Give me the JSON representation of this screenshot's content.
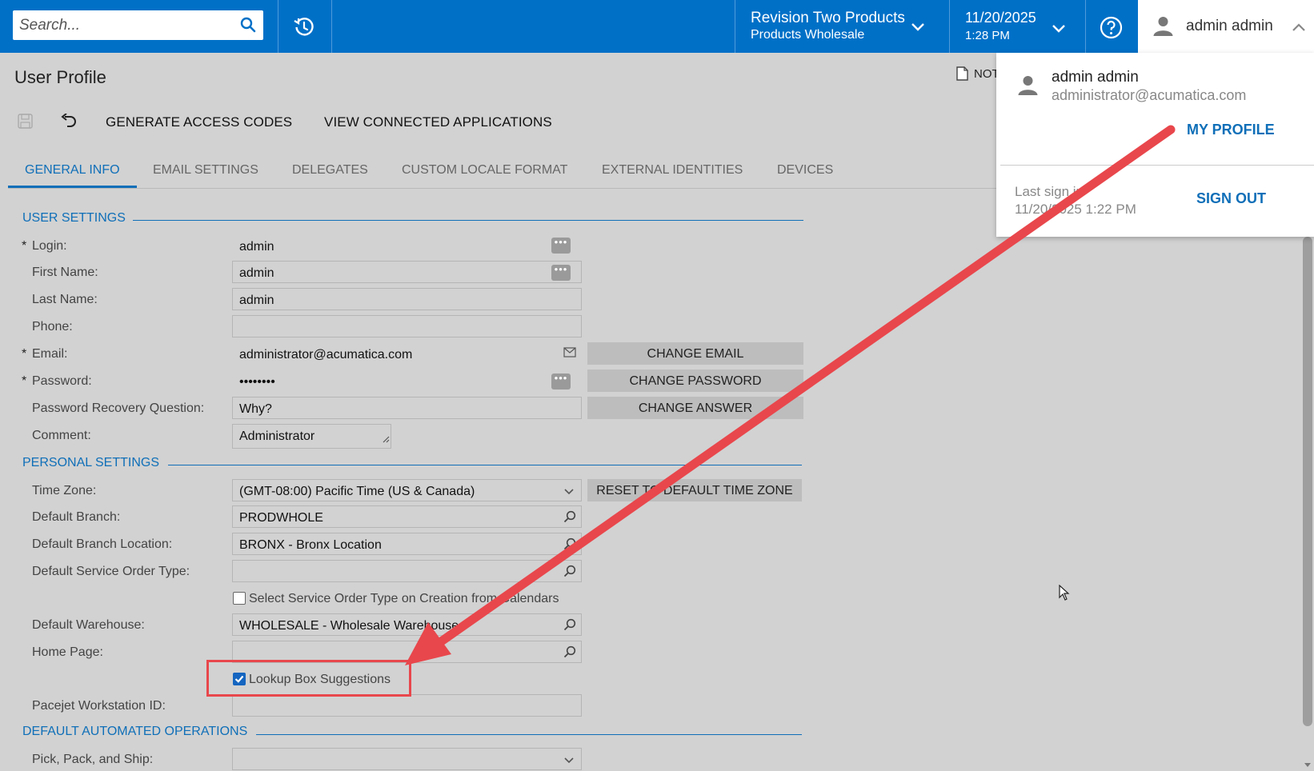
{
  "topbar": {
    "search_placeholder": "Search...",
    "company_name": "Revision Two Products",
    "branch_name": "Products Wholesale",
    "date": "11/20/2025",
    "time": "1:28 PM",
    "user_name": "admin admin"
  },
  "page": {
    "title": "User Profile",
    "notes_label": "NOT",
    "toolbar": {
      "generate_label": "GENERATE ACCESS CODES",
      "view_apps_label": "VIEW CONNECTED APPLICATIONS"
    },
    "tabs": [
      {
        "label": "GENERAL INFO"
      },
      {
        "label": "EMAIL SETTINGS"
      },
      {
        "label": "DELEGATES"
      },
      {
        "label": "CUSTOM LOCALE FORMAT"
      },
      {
        "label": "EXTERNAL IDENTITIES"
      },
      {
        "label": "DEVICES"
      }
    ]
  },
  "user_settings": {
    "section_title": "USER SETTINGS",
    "login_label": "Login:",
    "login_value": "admin",
    "first_name_label": "First Name:",
    "first_name_value": "admin",
    "last_name_label": "Last Name:",
    "last_name_value": "admin",
    "phone_label": "Phone:",
    "phone_value": "",
    "email_label": "Email:",
    "email_value": "administrator@acumatica.com",
    "change_email_label": "CHANGE EMAIL",
    "password_label": "Password:",
    "password_value": "••••••••",
    "change_password_label": "CHANGE PASSWORD",
    "recovery_label": "Password Recovery Question:",
    "recovery_value": "Why?",
    "change_answer_label": "CHANGE ANSWER",
    "comment_label": "Comment:",
    "comment_value": "Administrator"
  },
  "personal_settings": {
    "section_title": "PERSONAL SETTINGS",
    "timezone_label": "Time Zone:",
    "timezone_value": "(GMT-08:00) Pacific Time (US & Canada)",
    "reset_tz_label": "RESET TO DEFAULT TIME ZONE",
    "branch_label": "Default Branch:",
    "branch_value": "PRODWHOLE",
    "location_label": "Default Branch Location:",
    "location_value": "BRONX - Bronx Location",
    "service_order_label": "Default Service Order Type:",
    "service_order_value": "",
    "select_service_label": "Select Service Order Type on Creation from Calendars",
    "select_service_checked": false,
    "warehouse_label": "Default Warehouse:",
    "warehouse_value": "WHOLESALE - Wholesale Warehouse",
    "home_page_label": "Home Page:",
    "home_page_value": "",
    "lookup_label": "Lookup Box Suggestions",
    "lookup_checked": true,
    "pacejet_label": "Pacejet Workstation ID:",
    "pacejet_value": ""
  },
  "automated_ops": {
    "section_title": "DEFAULT AUTOMATED OPERATIONS",
    "pick_pack_label": "Pick, Pack, and Ship:",
    "pick_pack_value": ""
  },
  "user_menu": {
    "name": "admin admin",
    "email": "administrator@acumatica.com",
    "my_profile_label": "MY PROFILE",
    "last_signin_label": "Last sign in",
    "last_signin_value": "11/20/2025 1:22 PM",
    "sign_out_label": "SIGN OUT"
  },
  "colors": {
    "topbar": "#0070c7",
    "accent": "#0f6fb8",
    "annotation": "#e8474c"
  }
}
